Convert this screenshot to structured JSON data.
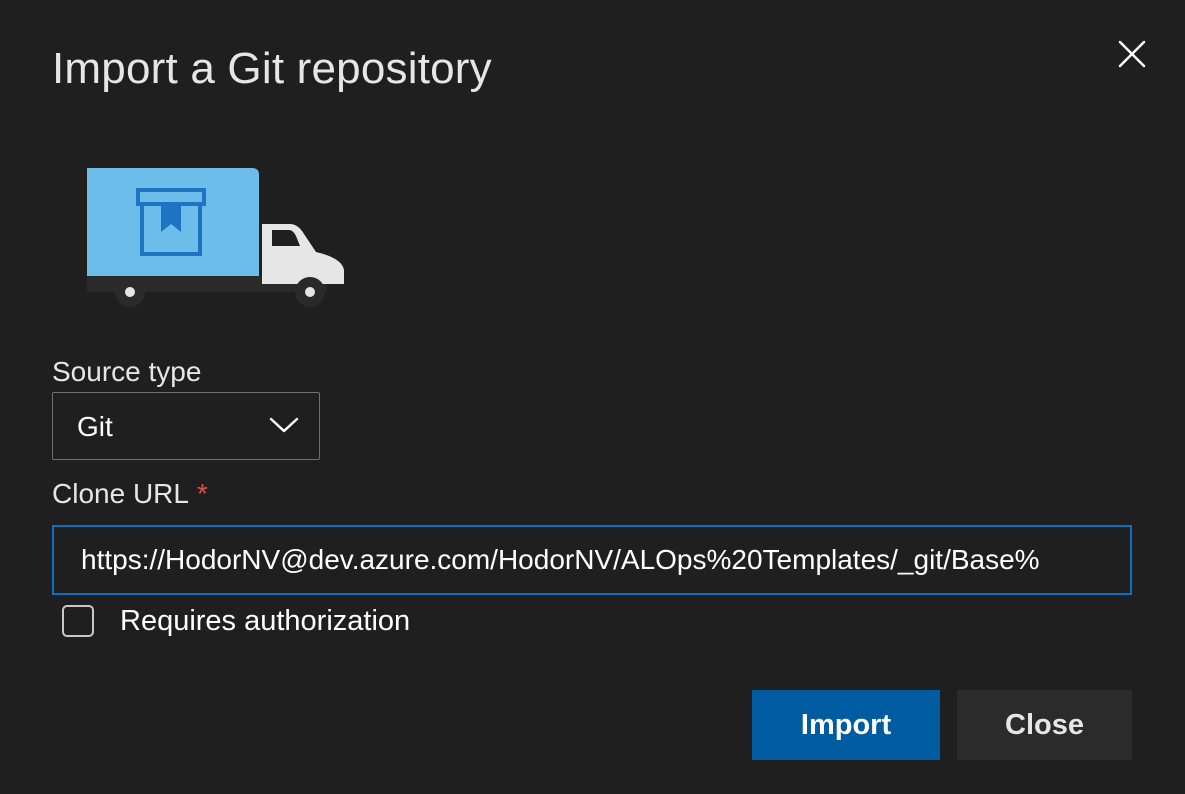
{
  "dialog": {
    "title": "Import a Git repository",
    "close_icon": "close-icon",
    "illustration_icon": "moving-truck-illustration"
  },
  "form": {
    "source_type": {
      "label": "Source type",
      "selected": "Git",
      "icon": "chevron-down-icon"
    },
    "clone_url": {
      "label": "Clone URL",
      "required_marker": "*",
      "value": "https://HodorNV@dev.azure.com/HodorNV/ALOps%20Templates/_git/Base%"
    },
    "requires_authorization": {
      "label": "Requires authorization",
      "checked": false
    }
  },
  "actions": {
    "import_label": "Import",
    "close_label": "Close"
  },
  "colors": {
    "background": "#201f1f",
    "primary_button": "#005ba1",
    "secondary_button": "#2b2b2b",
    "input_focus_border": "#0e70c0",
    "required": "#e0504e",
    "truck_box": "#6cbdea",
    "truck_box_icon": "#1e73c4"
  }
}
